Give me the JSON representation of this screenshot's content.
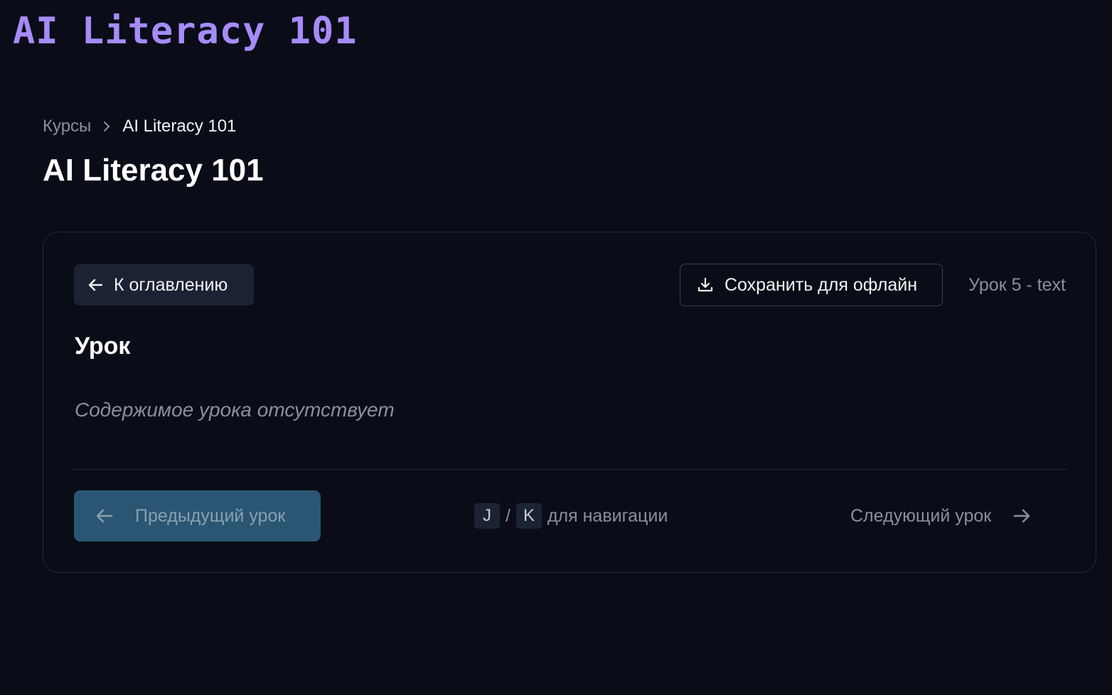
{
  "header": {
    "logo_text": "AI Literacy 101"
  },
  "breadcrumb": {
    "parent_label": "Курсы",
    "current_label": "AI Literacy 101"
  },
  "page": {
    "title": "AI Literacy 101"
  },
  "lesson": {
    "back_to_toc_label": "К оглавлению",
    "save_offline_label": "Сохранить для офлайн",
    "meta_label": "Урок 5 - text",
    "title": "Урок",
    "empty_message": "Содержимое урока отсутствует"
  },
  "navigation": {
    "prev_label": "Предыдущий урок",
    "next_label": "Следующий урок",
    "key_prev": "J",
    "key_separator": "/",
    "key_next": "K",
    "hint_label": "для навигации"
  },
  "icons": {
    "toc": "arrow-left-icon",
    "save": "download-icon",
    "breadcrumb_sep": "chevron-right-icon",
    "prev": "arrow-left-icon",
    "next": "arrow-right-icon"
  },
  "colors": {
    "background": "#0a0d17",
    "logo": "#a78bfa",
    "muted_text": "#8b8f9c",
    "prev_button_bg": "#2a5674"
  }
}
